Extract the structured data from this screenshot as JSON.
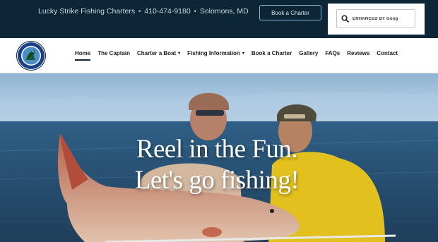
{
  "topbar": {
    "business_name": "Lucky Strike Fishing Charters",
    "separator": "•",
    "phone": "410-474-9180",
    "location": "Solomons, MD",
    "book_button_label": "Book a Charter",
    "search_placeholder": "ENHANCED BY Goog"
  },
  "nav": {
    "items": [
      {
        "label": "Home",
        "active": true
      },
      {
        "label": "The Captain"
      },
      {
        "label": "Charter a Boat",
        "has_dropdown": true
      },
      {
        "label": "Fishing Information",
        "has_dropdown": true
      },
      {
        "label": "Book a Charter"
      },
      {
        "label": "Gallery"
      },
      {
        "label": "FAQs"
      },
      {
        "label": "Reviews"
      },
      {
        "label": "Contact"
      }
    ],
    "caret": "▾"
  },
  "hero": {
    "line1": "Reel in the Fun.",
    "line2": "Let's go fishing!"
  },
  "colors": {
    "topbar_bg": "#0c2637",
    "accent": "#0c2637",
    "water": "#2f5f86"
  }
}
